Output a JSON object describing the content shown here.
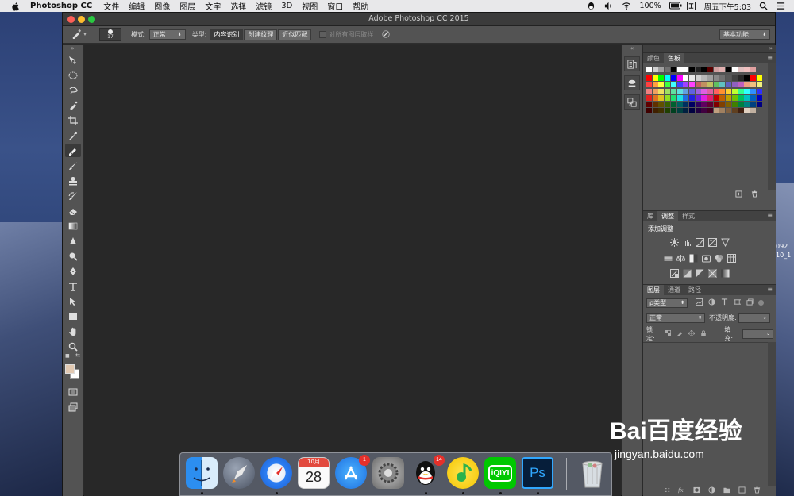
{
  "menubar": {
    "app_name": "Photoshop CC",
    "items": [
      "文件",
      "编辑",
      "图像",
      "图层",
      "文字",
      "选择",
      "滤镜",
      "3D",
      "视图",
      "窗口",
      "帮助"
    ],
    "battery": "100%",
    "clock": "周五下午5:03"
  },
  "window": {
    "title": "Adobe Photoshop CC 2015"
  },
  "options_bar": {
    "brush_size": "17",
    "mode_label": "模式:",
    "mode_value": "正常",
    "type_label": "类型:",
    "type_options": [
      "内容识别",
      "创建纹理",
      "近似匹配"
    ],
    "sample_all_layers": "对所有图层取样",
    "workspace": "基本功能"
  },
  "toolbar": {
    "tools": [
      "move-icon",
      "marquee-icon",
      "lasso-icon",
      "quick-select-icon",
      "crop-icon",
      "eyedropper-icon",
      "spot-healing-brush-icon",
      "brush-icon",
      "clone-stamp-icon",
      "history-brush-icon",
      "eraser-icon",
      "gradient-icon",
      "blur-icon",
      "dodge-icon",
      "pen-icon",
      "type-icon",
      "path-select-icon",
      "rectangle-icon",
      "hand-icon",
      "zoom-icon"
    ],
    "active_tool": "spot-healing-brush-icon",
    "foreground_color": "#e2c9b2",
    "background_color": "#ffffff"
  },
  "panels": {
    "color_tabs": [
      "颜色",
      "色板"
    ],
    "adjust_tabs": [
      "库",
      "调整",
      "样式"
    ],
    "adjust_title": "添加调整",
    "layers_tabs": [
      "图层",
      "通道",
      "路径"
    ],
    "layer_filter": "ρ类型",
    "blend_mode": "正常",
    "opacity_label": "不透明度:",
    "lock_label": "锁定:",
    "fill_label": "填充:",
    "panel_menu": "≡"
  },
  "swatch_rows": [
    [
      "#ffffff",
      "#d0d0d0",
      "#a0a0a0",
      "#707070",
      "#000000",
      "#ffffff",
      "#ffffff",
      "#000000",
      "#202020",
      "#000000",
      "#5a0000",
      "#d0a0a0",
      "#e0b0b0",
      "#000000",
      "#ffffff",
      "#e0c0c0",
      "#f0c0c0",
      "#e0a0a0"
    ],
    [
      "#ff0000",
      "#ffff00",
      "#00ff00",
      "#00ffff",
      "#0000ff",
      "#ff00ff",
      "#ffffff",
      "#e8e8e8",
      "#d0d0d0",
      "#b8b8b8",
      "#a0a0a0",
      "#888888",
      "#707070",
      "#585858",
      "#404040",
      "#282828",
      "#000000",
      "#ff0000",
      "#ffff00"
    ],
    [
      "#ff4040",
      "#ffa040",
      "#ffff40",
      "#40ff40",
      "#40ffff",
      "#4040ff",
      "#a040ff",
      "#ff40ff",
      "#c06060",
      "#c09060",
      "#c0c060",
      "#60c060",
      "#60c0c0",
      "#6060c0",
      "#9060c0",
      "#c060c0",
      "#f0a080",
      "#f0c080",
      "#f0f080"
    ],
    [
      "#f08080",
      "#f0a060",
      "#f0e060",
      "#a0e060",
      "#60e0a0",
      "#60e0e0",
      "#60a0e0",
      "#6060e0",
      "#a060e0",
      "#e060e0",
      "#e060a0",
      "#ff6060",
      "#ff9030",
      "#ffd030",
      "#c0ff30",
      "#30ff90",
      "#30ffff",
      "#3090ff",
      "#3030ff"
    ],
    [
      "#e02020",
      "#e07020",
      "#e0c020",
      "#90e020",
      "#20e070",
      "#20e0e0",
      "#2070e0",
      "#2020e0",
      "#7020e0",
      "#e020e0",
      "#e02070",
      "#c00000",
      "#c06000",
      "#c0a000",
      "#70c000",
      "#00c060",
      "#00c0c0",
      "#0060c0",
      "#0000c0"
    ],
    [
      "#600000",
      "#603000",
      "#605000",
      "#386000",
      "#006030",
      "#006060",
      "#003060",
      "#000060",
      "#300060",
      "#600060",
      "#600030",
      "#800000",
      "#804000",
      "#806000",
      "#408000",
      "#008040",
      "#008080",
      "#004080",
      "#000080"
    ],
    [
      "#400000",
      "#402000",
      "#403000",
      "#204000",
      "#004020",
      "#004040",
      "#002040",
      "#000040",
      "#200040",
      "#400040",
      "#400020",
      "#c0a080",
      "#a08060",
      "#806040",
      "#604020",
      "#402010",
      "#e0d0c0",
      "#c0b0a0"
    ]
  ],
  "dock": {
    "apps": [
      "finder-icon",
      "launchpad-icon",
      "safari-icon",
      "calendar-icon",
      "app-store-icon",
      "system-preferences-icon",
      "qq-icon",
      "qq-music-icon",
      "iqiyi-icon",
      "photoshop-icon",
      "trash-icon"
    ],
    "calendar_month": "10月",
    "calendar_day": "28",
    "app_store_badge": "1",
    "qq_badge": "14",
    "iqiyi_label": "iQIYI",
    "ps_label": "Ps"
  },
  "desktop": {
    "file_label_1": "092",
    "file_label_2": "10_1"
  },
  "watermark": {
    "logo": "Bai百度经验",
    "url": "jingyan.baidu.com"
  }
}
